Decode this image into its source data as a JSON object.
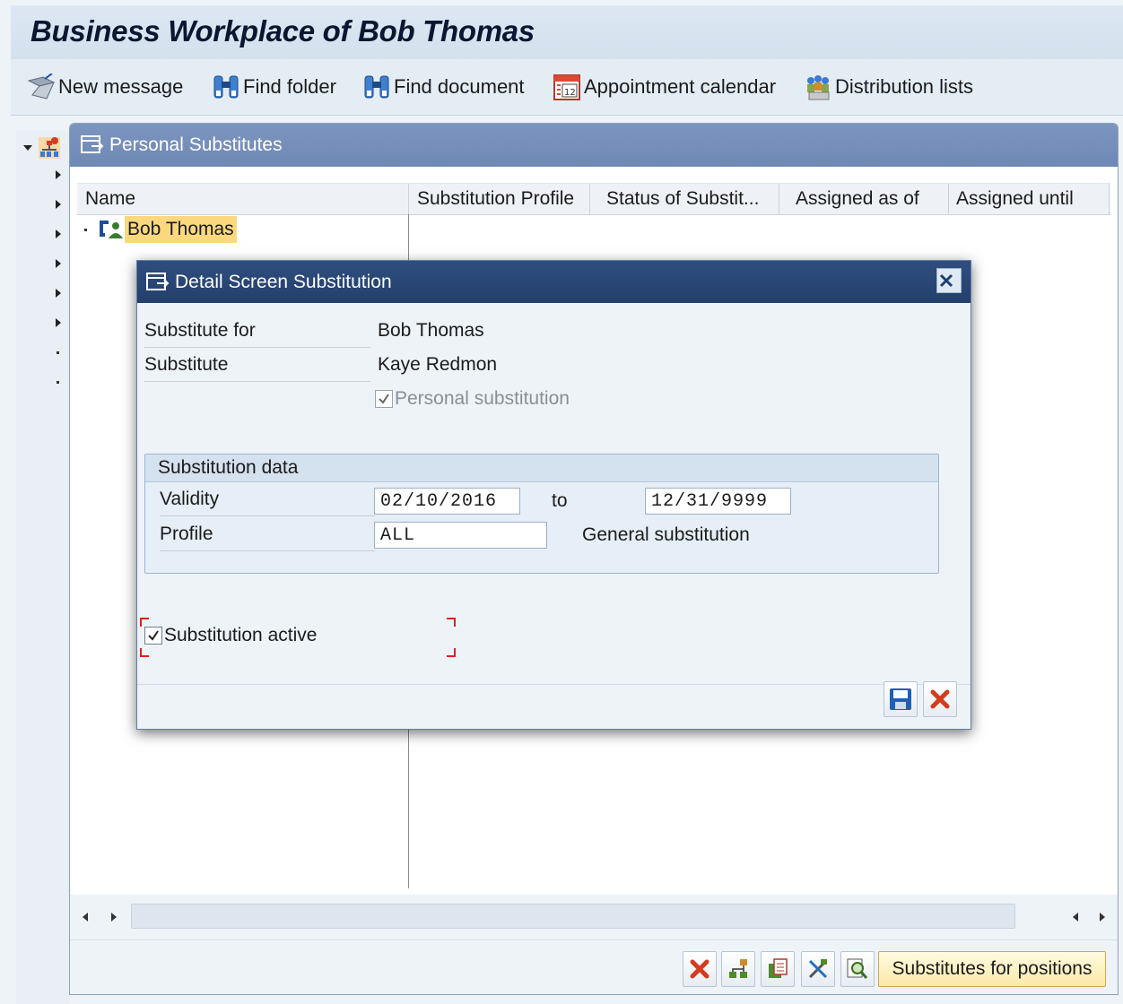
{
  "window": {
    "title": "Business Workplace of Bob Thomas"
  },
  "toolbar": {
    "items": [
      {
        "label": "New message",
        "icon": "new-message-icon"
      },
      {
        "label": "Find folder",
        "icon": "binoculars-icon"
      },
      {
        "label": "Find document",
        "icon": "binoculars-icon"
      },
      {
        "label": "Appointment calendar",
        "icon": "calendar-icon"
      },
      {
        "label": "Distribution lists",
        "icon": "distribution-list-icon"
      }
    ]
  },
  "panel": {
    "title": "Personal Substitutes",
    "columns": [
      "Name",
      "Substitution Profile",
      "Status of Substit...",
      "Assigned as of",
      "Assigned until"
    ],
    "rows": [
      {
        "name": "Bob Thomas"
      }
    ],
    "footer": {
      "positions_button": "Substitutes for positions"
    }
  },
  "dialog": {
    "title": "Detail Screen Substitution",
    "substitute_for_label": "Substitute for",
    "substitute_for_value": "Bob Thomas",
    "substitute_label": "Substitute",
    "substitute_value": "Kaye Redmon",
    "personal_substitution": {
      "label": "Personal substitution",
      "checked": true
    },
    "group": {
      "title": "Substitution data",
      "validity_label": "Validity",
      "validity_from": "02/10/2016",
      "to_label": "to",
      "validity_to": "12/31/9999",
      "profile_label": "Profile",
      "profile_value": "ALL",
      "profile_desc": "General substitution"
    },
    "active": {
      "label": "Substitution active",
      "checked": true
    }
  },
  "colors": {
    "accent": "#233f6c",
    "highlight": "#fbd87d",
    "panel_header": "#7c95bf"
  }
}
